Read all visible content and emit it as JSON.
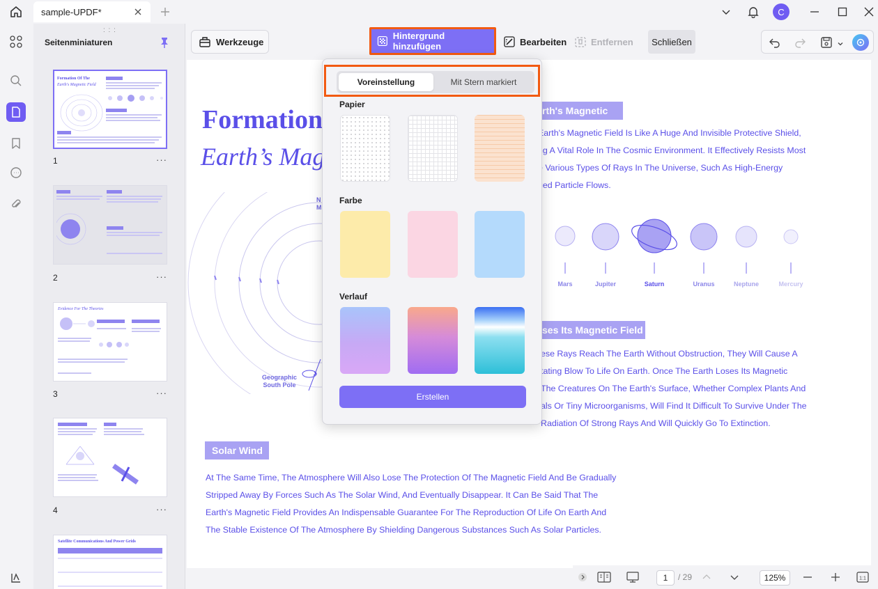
{
  "titlebar": {
    "tab_title": "sample-UPDF*",
    "avatar_letter": "C"
  },
  "sidebar": {
    "title": "Seitenminiaturen",
    "pages": [
      {
        "number": "1",
        "more": "···"
      },
      {
        "number": "2",
        "more": "···"
      },
      {
        "number": "3",
        "more": "···"
      },
      {
        "number": "4",
        "more": "···"
      }
    ]
  },
  "toolbar": {
    "werkzeuge_label": "Werkzeuge",
    "add_background_label": "Hintergrund hinzufügen",
    "edit_label": "Bearbeiten",
    "remove_label": "Entfernen",
    "close_label": "Schließen"
  },
  "popup": {
    "tab_preset": "Voreinstellung",
    "tab_starred": "Mit Stern markiert",
    "section_paper": "Papier",
    "section_color": "Farbe",
    "section_gradient": "Verlauf",
    "create_label": "Erstellen",
    "colors": {
      "yellow": "#fdebaa",
      "pink": "#fbd6e3",
      "blue": "#b4dafc",
      "accent": "#7d6ff5",
      "highlight_border": "#f25a12"
    }
  },
  "document": {
    "title": "Formation",
    "subtitle": "Earth’s Mag",
    "section1_title": "rth's Magnetic",
    "section1_lines": [
      "Earth's Magnetic Field Is Like A Huge And Invisible Protective Shield,",
      "ng A Vital Role In The Cosmic Environment. It Effectively Resists Most",
      "e Various Types Of Rays In The Universe, Such As High-Energy",
      "ged Particle Flows."
    ],
    "planets": [
      "Mars",
      "Jupiter",
      "Saturn",
      "Uranus",
      "Neptune",
      "Mercury"
    ],
    "geo_label_1": "Geographic",
    "geo_label_2": "South Pole",
    "north_label_1": "N",
    "north_label_2": "M",
    "section2_title": "ses Its Magnetic Field",
    "section2_lines": [
      "ese Rays Reach The Earth Without Obstruction, They Will Cause A",
      "tating Blow To Life On Earth. Once The Earth Loses Its Magnetic",
      " The Creatures On The Earth's Surface, Whether Complex Plants And",
      "als Or Tiny Microorganisms, Will Find It Difficult To Survive Under The",
      "Radiation Of Strong Rays And Will Quickly Go To Extinction."
    ],
    "section3_title": "Solar Wind",
    "section3_lines": [
      "At The Same Time, The Atmosphere Will Also Lose The Protection Of The Magnetic Field And Be Gradually",
      "Stripped Away By Forces Such As The Solar Wind, And Eventually Disappear. It Can Be Said That The",
      "Earth's Magnetic Field Provides An Indispensable Guarantee For The Reproduction Of Life On Earth And",
      "The Stable Existence Of The Atmosphere By Shielding Dangerous Substances Such As Solar Particles."
    ]
  },
  "bottombar": {
    "current_page": "1",
    "total_pages": "/ 29",
    "zoom": "125%"
  }
}
